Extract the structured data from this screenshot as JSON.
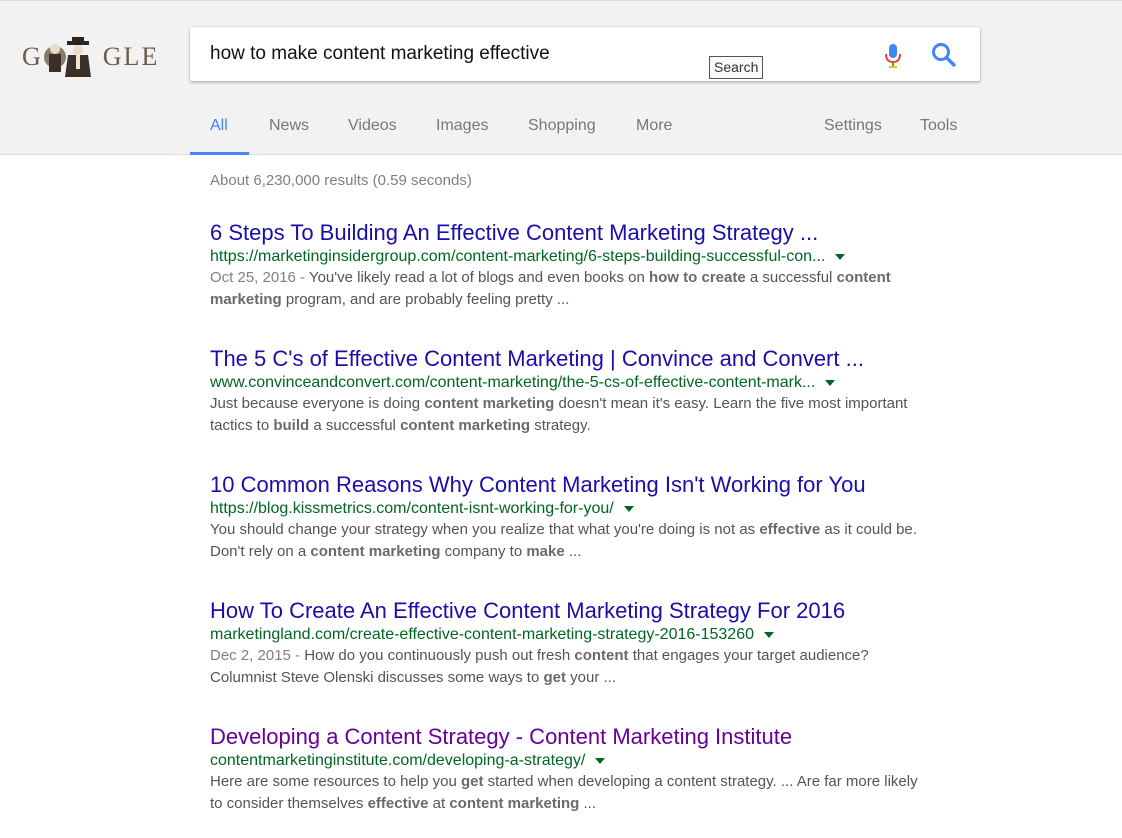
{
  "search": {
    "query": "how to make content marketing effective",
    "tooltip": "Search"
  },
  "logo": {
    "text_left": "G",
    "text_right": "GLE"
  },
  "tabs": [
    {
      "label": "All"
    },
    {
      "label": "News"
    },
    {
      "label": "Videos"
    },
    {
      "label": "Images"
    },
    {
      "label": "Shopping"
    },
    {
      "label": "More"
    },
    {
      "label": "Settings"
    },
    {
      "label": "Tools"
    }
  ],
  "stats": "About 6,230,000 results (0.59 seconds)",
  "results": [
    {
      "title": "6 Steps To Building An Effective Content Marketing Strategy ...",
      "url": "https://marketinginsidergroup.com/content-marketing/6-steps-building-successful-con...",
      "date": "Oct 25, 2016 - ",
      "line1": [
        {
          "t": "You've likely read a lot of blogs and even books on "
        },
        {
          "t": "how to create",
          "b": true
        },
        {
          "t": " a successful "
        },
        {
          "t": "content",
          "b": true
        }
      ],
      "line2": [
        {
          "t": "marketing",
          "b": true
        },
        {
          "t": " program, and are probably feeling pretty ..."
        }
      ]
    },
    {
      "title": "The 5 C's of Effective Content Marketing | Convince and Convert ...",
      "url": "www.convinceandconvert.com/content-marketing/the-5-cs-of-effective-content-mark...",
      "date": "",
      "line1": [
        {
          "t": "Just because everyone is doing "
        },
        {
          "t": "content marketing",
          "b": true
        },
        {
          "t": " doesn't mean it's easy. Learn the five most important"
        }
      ],
      "line2": [
        {
          "t": "tactics to "
        },
        {
          "t": "build",
          "b": true
        },
        {
          "t": " a successful "
        },
        {
          "t": "content marketing",
          "b": true
        },
        {
          "t": " strategy."
        }
      ]
    },
    {
      "title": "10 Common Reasons Why Content Marketing Isn't Working for You",
      "url": "https://blog.kissmetrics.com/content-isnt-working-for-you/",
      "date": "",
      "line1": [
        {
          "t": "You should change your strategy when you realize that what you're doing is not as "
        },
        {
          "t": "effective",
          "b": true
        },
        {
          "t": " as it could be."
        }
      ],
      "line2": [
        {
          "t": "Don't rely on a "
        },
        {
          "t": "content marketing",
          "b": true
        },
        {
          "t": " company to "
        },
        {
          "t": "make",
          "b": true
        },
        {
          "t": " ..."
        }
      ]
    },
    {
      "title": "How To Create An Effective Content Marketing Strategy For 2016",
      "url": "marketingland.com/create-effective-content-marketing-strategy-2016-153260",
      "date": "Dec 2, 2015 - ",
      "line1": [
        {
          "t": "How do you continuously push out fresh "
        },
        {
          "t": "content",
          "b": true
        },
        {
          "t": " that engages your target audience?"
        }
      ],
      "line2": [
        {
          "t": "Columnist Steve Olenski discusses some ways to "
        },
        {
          "t": "get",
          "b": true
        },
        {
          "t": " your ..."
        }
      ]
    },
    {
      "title": "Developing a Content Strategy - Content Marketing Institute",
      "visited": true,
      "url": "contentmarketinginstitute.com/developing-a-strategy/",
      "date": "",
      "line1": [
        {
          "t": "Here are some resources to help you "
        },
        {
          "t": "get",
          "b": true
        },
        {
          "t": " started when developing a content strategy. ... Are far more likely"
        }
      ],
      "line2": [
        {
          "t": "to consider themselves "
        },
        {
          "t": "effective",
          "b": true
        },
        {
          "t": " at "
        },
        {
          "t": "content marketing",
          "b": true
        },
        {
          "t": " ..."
        }
      ]
    }
  ],
  "colors": {
    "link": "#1a0dab",
    "visited": "#660099",
    "url": "#006621",
    "accent": "#4285f4"
  },
  "icons": [
    "microphone-icon",
    "search-icon",
    "dropdown-caret-icon",
    "doodle-logo"
  ]
}
